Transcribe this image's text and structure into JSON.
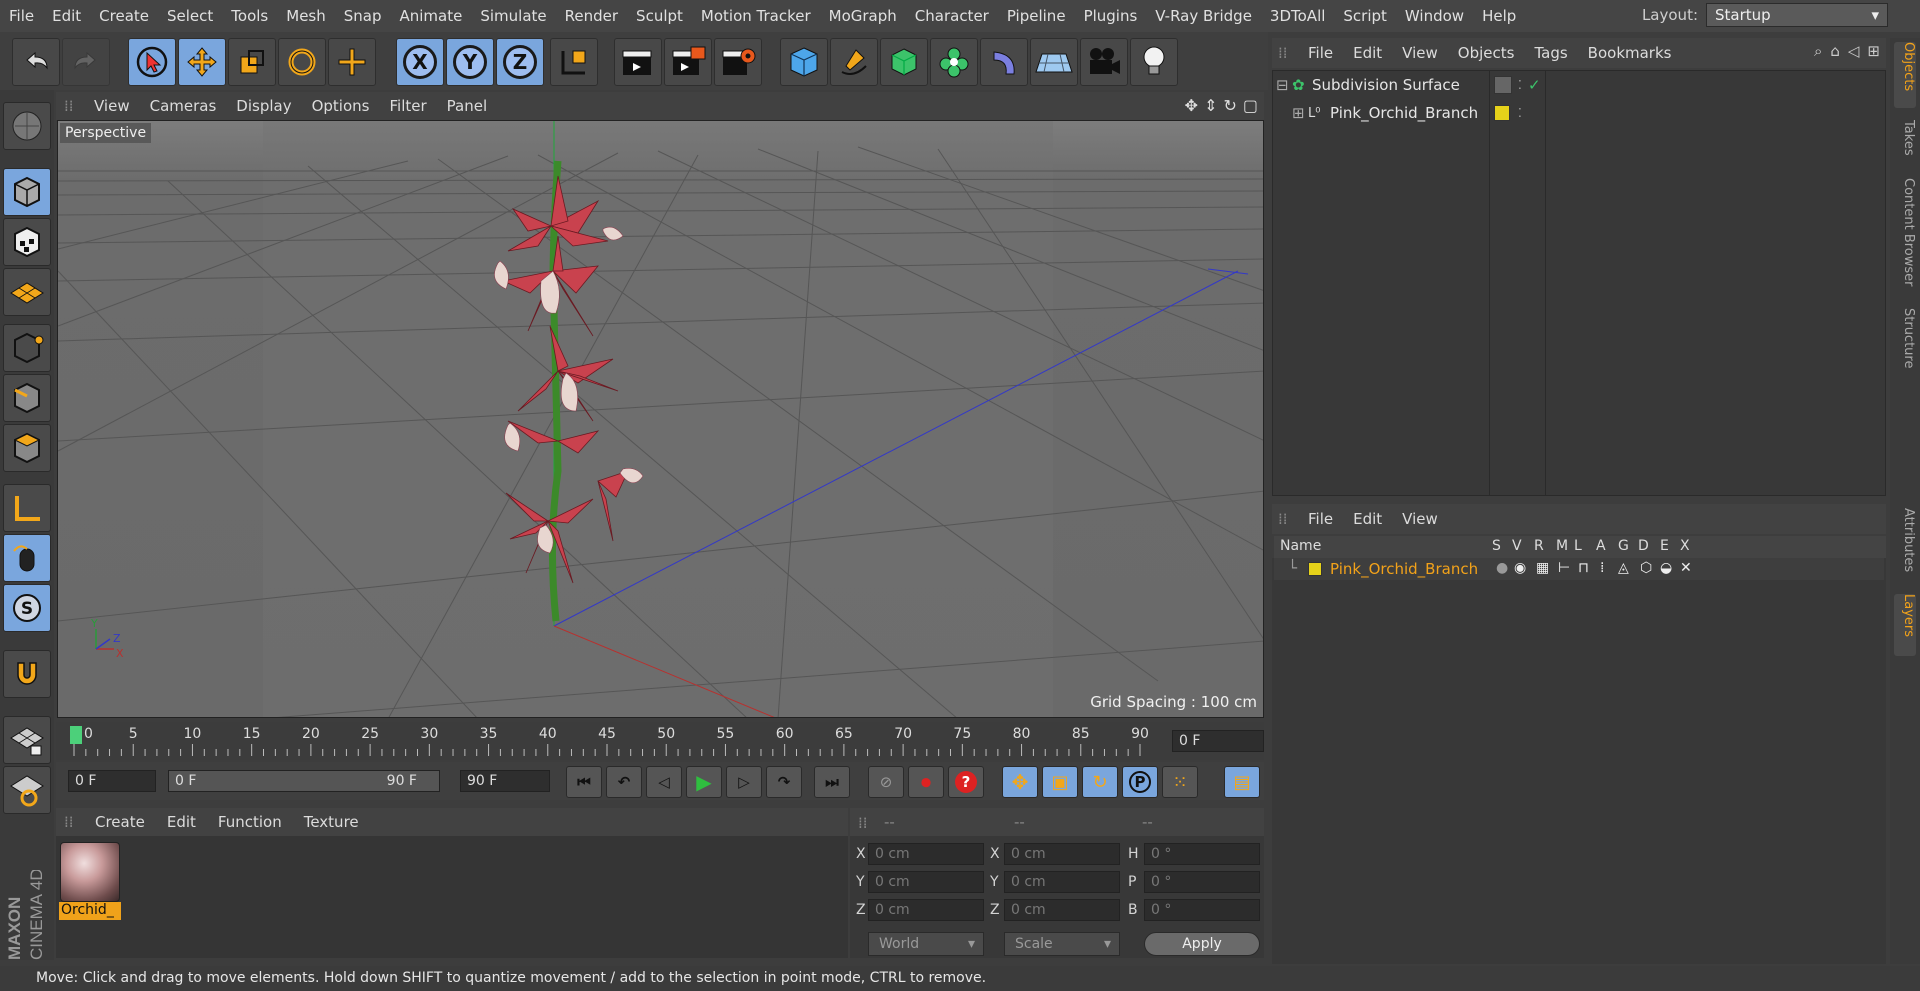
{
  "menubar": {
    "items": [
      "File",
      "Edit",
      "Create",
      "Select",
      "Tools",
      "Mesh",
      "Snap",
      "Animate",
      "Simulate",
      "Render",
      "Sculpt",
      "Motion Tracker",
      "MoGraph",
      "Character",
      "Pipeline",
      "Plugins",
      "V-Ray Bridge",
      "3DToAll",
      "Script",
      "Window",
      "Help"
    ],
    "layout_label": "Layout:",
    "layout_value": "Startup"
  },
  "toolbar": {
    "axis_x": "X",
    "axis_y": "Y",
    "axis_z": "Z"
  },
  "viewport": {
    "menu": [
      "View",
      "Cameras",
      "Display",
      "Options",
      "Filter",
      "Panel"
    ],
    "camera_label": "Perspective",
    "grid_spacing": "Grid Spacing : 100 cm"
  },
  "timeline": {
    "ticks": [
      "0",
      "5",
      "10",
      "15",
      "20",
      "25",
      "30",
      "35",
      "40",
      "45",
      "50",
      "55",
      "60",
      "65",
      "70",
      "75",
      "80",
      "85",
      "90"
    ],
    "current_frame": "0 F"
  },
  "playbar": {
    "start_frame": "0 F",
    "range_start": "0 F",
    "range_end": "90 F",
    "end_frame": "90 F"
  },
  "material_manager": {
    "menu": [
      "Create",
      "Edit",
      "Function",
      "Texture"
    ],
    "material_name": "Orchid_"
  },
  "coordinates": {
    "header": [
      "--",
      "--",
      "--"
    ],
    "pos_labels": [
      "X",
      "Y",
      "Z"
    ],
    "size_labels": [
      "X",
      "Y",
      "Z"
    ],
    "rot_labels": [
      "H",
      "P",
      "B"
    ],
    "pos_values": [
      "0 cm",
      "0 cm",
      "0 cm"
    ],
    "size_values": [
      "0 cm",
      "0 cm",
      "0 cm"
    ],
    "rot_values": [
      "0 °",
      "0 °",
      "0 °"
    ],
    "mode_world": "World",
    "mode_scale": "Scale",
    "apply_label": "Apply"
  },
  "object_manager": {
    "menu": [
      "File",
      "Edit",
      "View",
      "Objects",
      "Tags",
      "Bookmarks"
    ],
    "objects": [
      {
        "name": "Subdivision Surface"
      },
      {
        "name": "Pink_Orchid_Branch"
      }
    ]
  },
  "layer_manager": {
    "menu": [
      "File",
      "Edit",
      "View"
    ],
    "columns": [
      "Name",
      "S",
      "V",
      "R",
      "M",
      "L",
      "A",
      "G",
      "D",
      "E",
      "X"
    ],
    "layers": [
      {
        "name": "Pink_Orchid_Branch",
        "color": "#e6d21a"
      }
    ]
  },
  "right_tabs": [
    "Objects",
    "Takes",
    "Content Browser",
    "Structure",
    "Attributes",
    "Layers"
  ],
  "statusbar": {
    "text": "Move: Click and drag to move elements. Hold down SHIFT to quantize movement / add to the selection in point mode, CTRL to remove."
  },
  "branding": {
    "line1": "MAXON",
    "line2": "CINEMA 4D"
  },
  "colors": {
    "accent": "#f0a21a",
    "highlight": "#7aa6dd",
    "layer_color": "#e6d21a"
  }
}
